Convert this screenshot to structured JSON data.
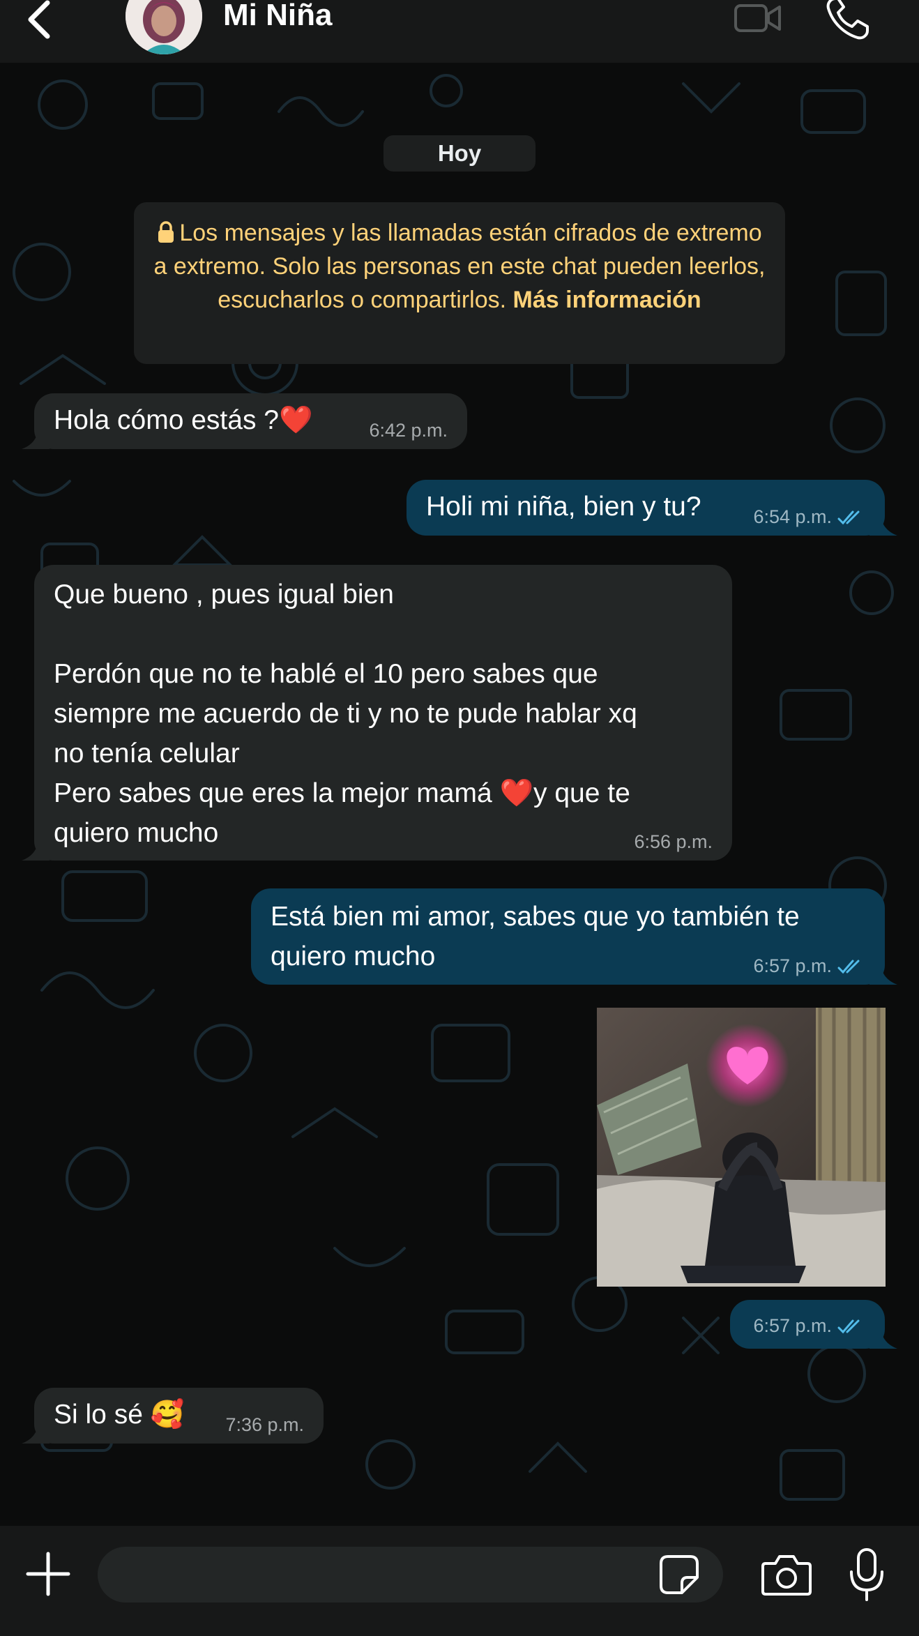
{
  "header": {
    "contact_name": "Mi Niña",
    "icons": {
      "back": "chevron-left-icon",
      "video": "video-camera-icon",
      "call": "phone-icon"
    }
  },
  "chat": {
    "date_label": "Hoy",
    "encryption_notice": {
      "text": "Los mensajes y las llamadas están cifrados de extremo a extremo. Solo las personas en este chat pueden leerlos, escucharlos o compartirlos.",
      "link": "Más información"
    },
    "messages": [
      {
        "direction": "incoming",
        "text": "Hola cómo estás ?",
        "emoji": "❤️",
        "time": "6:42 p.m."
      },
      {
        "direction": "outgoing",
        "text": "Holi mi niña, bien y tu?",
        "time": "6:54 p.m.",
        "status": "read"
      },
      {
        "direction": "incoming",
        "lines": [
          "Que bueno , pues igual bien",
          "",
          "Perdón que no te hablé el 10 pero sabes que",
          "siempre me acuerdo de ti y no te pude hablar xq",
          "no tenía celular",
          "Pero sabes que eres la mejor mamá ",
          "quiero mucho"
        ],
        "heart_emoji": "❤️",
        "line5_tail": "y que te",
        "time": "6:56 p.m."
      },
      {
        "direction": "outgoing",
        "lines": [
          "Está bien mi amor, sabes que yo también te",
          "quiero mucho"
        ],
        "time": "6:57 p.m.",
        "status": "read"
      },
      {
        "direction": "outgoing",
        "type": "photo",
        "time": "6:57 p.m.",
        "status": "read"
      },
      {
        "direction": "incoming",
        "text": "Si lo sé",
        "emoji": "🥰",
        "time": "7:36 p.m."
      }
    ]
  },
  "input_bar": {
    "placeholder": "",
    "icons": {
      "attach": "plus-icon",
      "sticker": "sticker-icon",
      "camera": "camera-icon",
      "mic": "microphone-icon"
    }
  },
  "colors": {
    "background": "#0b0c0c",
    "bar": "#171818",
    "incoming_bubble": "#232626",
    "outgoing_bubble": "#0b3b53",
    "notice_text": "#ffd279",
    "read_ticks": "#53bdeb"
  }
}
